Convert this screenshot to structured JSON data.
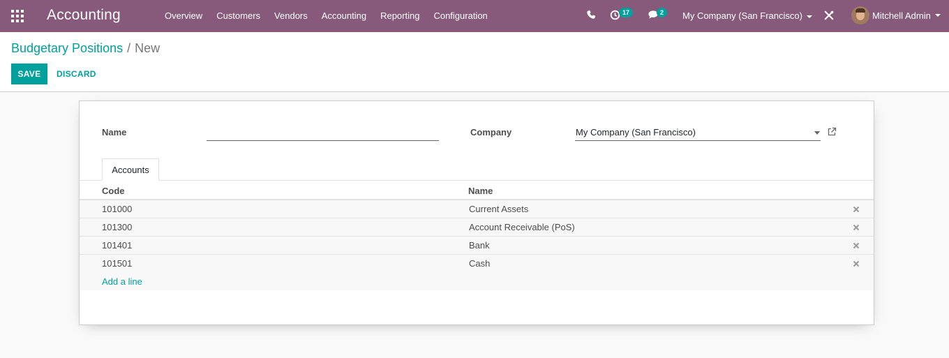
{
  "navbar": {
    "app_title": "Accounting",
    "menu": [
      "Overview",
      "Customers",
      "Vendors",
      "Accounting",
      "Reporting",
      "Configuration"
    ],
    "activity_count": "17",
    "message_count": "2",
    "company": "My Company (San Francisco)",
    "user": "Mitchell Admin"
  },
  "breadcrumb": {
    "parent": "Budgetary Positions",
    "separator": "/",
    "current": "New"
  },
  "buttons": {
    "save": "Save",
    "discard": "Discard"
  },
  "form": {
    "name_label": "Name",
    "name_value": "",
    "company_label": "Company",
    "company_value": "My Company (San Francisco)"
  },
  "tabs": [
    "Accounts"
  ],
  "accounts_table": {
    "headers": [
      "Code",
      "Name"
    ],
    "rows": [
      {
        "code": "101000",
        "name": "Current Assets"
      },
      {
        "code": "101300",
        "name": "Account Receivable (PoS)"
      },
      {
        "code": "101401",
        "name": "Bank"
      },
      {
        "code": "101501",
        "name": "Cash"
      }
    ],
    "add_line": "Add a line"
  },
  "colors": {
    "navbar": "#875a7b",
    "accent": "#00a09d"
  }
}
